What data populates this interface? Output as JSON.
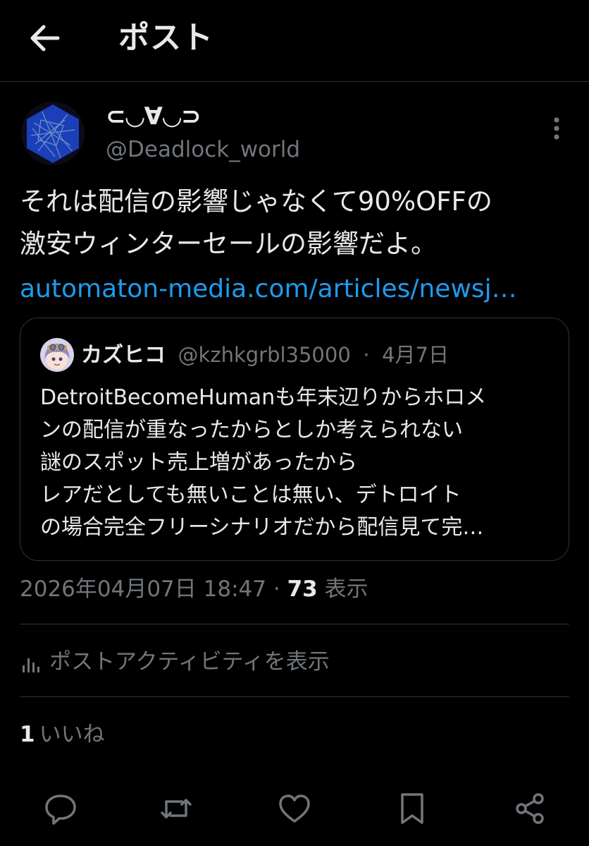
{
  "header": {
    "title": "ポスト",
    "back_icon": "arrow-left-icon"
  },
  "post": {
    "author": {
      "display_name": "⊂◡∀◡⊃",
      "handle": "@Deadlock_world"
    },
    "text_lines": [
      "それは配信の影響じゃなくて90%OFFの",
      "激安ウィンターセールの影響だよ。"
    ],
    "link": "automaton-media.com/articles/newsj…",
    "quote": {
      "name": "カズヒコ",
      "handle": "@kzhkgrbl35000",
      "separator": "·",
      "date": "4月7日",
      "lines": [
        "DetroitBecomeHumanも年末辺りからホロメ",
        "ンの配信が重なったからとしか考えられない",
        "謎のスポット売上増があったから",
        "レアだとしても無いことは無い、デトロイト",
        "の場合完全フリーシナリオだから配信見て完…"
      ]
    },
    "timestamp": "2026年04月07日 18:47",
    "separator": "·",
    "views_count": "73",
    "views_label": "表示",
    "activity_label": "ポストアクティビティを表示",
    "likes_count": "1",
    "likes_label": "いいね"
  },
  "actions": {
    "reply_icon": "reply-icon",
    "repost_icon": "repost-icon",
    "like_icon": "heart-icon",
    "bookmark_icon": "bookmark-icon",
    "share_icon": "share-icon"
  },
  "colors": {
    "background": "#000000",
    "text": "#e7e9ea",
    "muted": "#71767b",
    "link": "#1d9bf0",
    "border": "#2f3336",
    "avatar_blue": "#1a3fb8"
  }
}
